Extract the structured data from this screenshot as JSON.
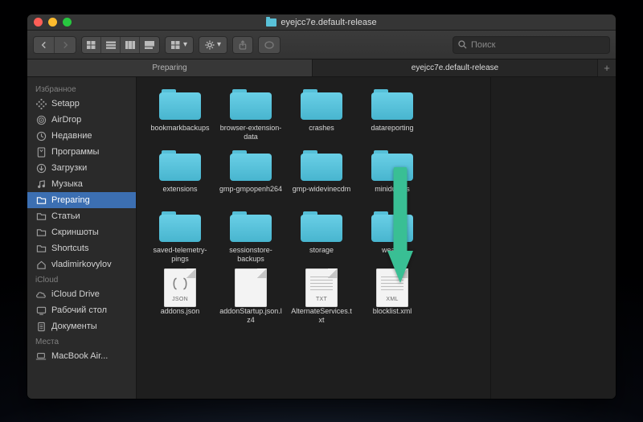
{
  "window": {
    "title": "eyejcc7e.default-release"
  },
  "toolbar": {
    "search_placeholder": "Поиск"
  },
  "tabs": [
    {
      "label": "Preparing",
      "active": false
    },
    {
      "label": "eyejcc7e.default-release",
      "active": true
    }
  ],
  "sidebar": {
    "sections": [
      {
        "title": "Избранное",
        "items": [
          {
            "icon": "setapp",
            "label": "Setapp"
          },
          {
            "icon": "airdrop",
            "label": "AirDrop"
          },
          {
            "icon": "recents",
            "label": "Недавние"
          },
          {
            "icon": "apps",
            "label": "Программы"
          },
          {
            "icon": "downloads",
            "label": "Загрузки"
          },
          {
            "icon": "music",
            "label": "Музыка"
          },
          {
            "icon": "folder",
            "label": "Preparing",
            "selected": true
          },
          {
            "icon": "folder",
            "label": "Статьи"
          },
          {
            "icon": "folder",
            "label": "Скриншоты"
          },
          {
            "icon": "folder",
            "label": "Shortcuts"
          },
          {
            "icon": "home",
            "label": "vladimirkovylov"
          }
        ]
      },
      {
        "title": "iCloud",
        "items": [
          {
            "icon": "icloud",
            "label": "iCloud Drive"
          },
          {
            "icon": "desktop",
            "label": "Рабочий стол"
          },
          {
            "icon": "docs",
            "label": "Документы"
          }
        ]
      },
      {
        "title": "Места",
        "items": [
          {
            "icon": "laptop",
            "label": "MacBook Air..."
          }
        ]
      }
    ]
  },
  "files": [
    {
      "type": "folder",
      "name": "bookmarkbackups"
    },
    {
      "type": "folder",
      "name": "browser-extension-data"
    },
    {
      "type": "folder",
      "name": "crashes"
    },
    {
      "type": "folder",
      "name": "datareporting"
    },
    {
      "type": "folder",
      "name": "extensions"
    },
    {
      "type": "folder",
      "name": "gmp-gmpopenh264"
    },
    {
      "type": "folder",
      "name": "gmp-widevinecdm"
    },
    {
      "type": "folder",
      "name": "minidumps"
    },
    {
      "type": "folder",
      "name": "saved-telemetry-pings"
    },
    {
      "type": "folder",
      "name": "sessionstore-backups"
    },
    {
      "type": "folder",
      "name": "storage"
    },
    {
      "type": "folder",
      "name": "weave"
    },
    {
      "type": "file",
      "ext": "JSON",
      "name": "addons.json"
    },
    {
      "type": "file",
      "ext": "",
      "name": "addonStartup.json.lz4"
    },
    {
      "type": "file",
      "ext": "TXT",
      "name": "AlternateServices.txt"
    },
    {
      "type": "file",
      "ext": "XML",
      "name": "blocklist.xml"
    }
  ],
  "colors": {
    "accent": "#4cc2a0",
    "folder": "#55c2da"
  }
}
